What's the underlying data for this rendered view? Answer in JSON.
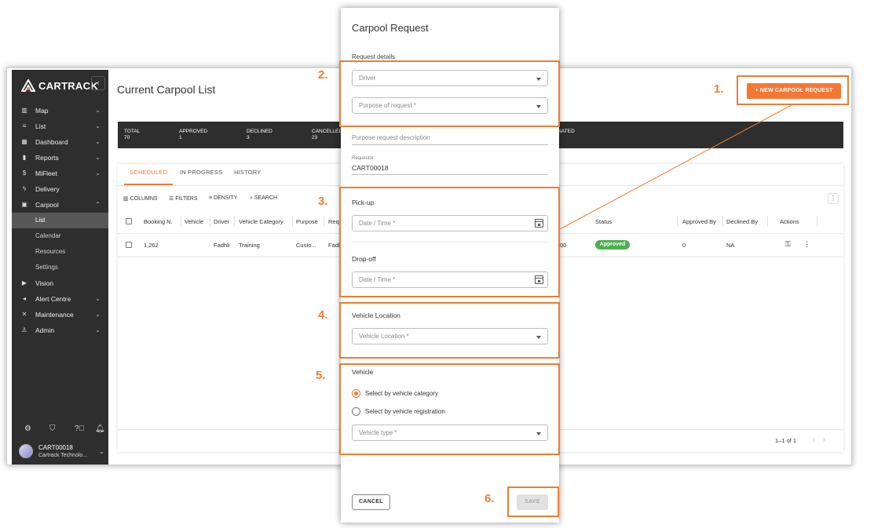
{
  "app": {
    "brand": "CARTRACK",
    "sidebar": {
      "items": [
        {
          "label": "Map",
          "icon": "map-icon",
          "chevron": true
        },
        {
          "label": "List",
          "icon": "list-icon",
          "chevron": true
        },
        {
          "label": "Dashboard",
          "icon": "dashboard-icon",
          "chevron": true
        },
        {
          "label": "Reports",
          "icon": "reports-icon",
          "chevron": true
        },
        {
          "label": "MiFleet",
          "icon": "dollar-icon",
          "chevron": true
        },
        {
          "label": "Delivery",
          "icon": "bolt-icon",
          "chevron": false
        },
        {
          "label": "Carpool",
          "icon": "calendar-icon",
          "chevron": true
        }
      ],
      "carpool_sub": [
        {
          "label": "List",
          "active": true
        },
        {
          "label": "Calendar",
          "active": false
        },
        {
          "label": "Resources",
          "active": false
        },
        {
          "label": "Settings",
          "active": false
        }
      ],
      "items_after": [
        {
          "label": "Vision",
          "icon": "camera-icon",
          "chevron": false
        },
        {
          "label": "Alert Centre",
          "icon": "alert-icon",
          "chevron": true
        },
        {
          "label": "Maintenance",
          "icon": "tools-icon",
          "chevron": true
        },
        {
          "label": "Admin",
          "icon": "admin-icon",
          "chevron": true
        }
      ],
      "user": {
        "name": "CART00018",
        "company": "Cartrack Technolo..."
      }
    },
    "main": {
      "title": "Current Carpool List",
      "new_button": "NEW CARPOOL REQUEST",
      "stats": [
        {
          "label": "TOTAL",
          "value": "70"
        },
        {
          "label": "APPROVED",
          "value": "1"
        },
        {
          "label": "DECLINED",
          "value": "3"
        },
        {
          "label": "CANCELLED",
          "value": "23"
        },
        {
          "label": "TERMINATED",
          "value": ""
        }
      ],
      "tabs": [
        "SCHEDULED",
        "IN PROGRESS",
        "HISTORY"
      ],
      "toolbar": [
        "COLUMNS",
        "FILTERS",
        "DENSITY",
        "SEARCH"
      ],
      "columns": [
        "Booking N.",
        "Vehicle",
        "Driver",
        "Vehicle Category",
        "Purpose",
        "Req",
        "Status",
        "Approved By",
        "Declined By",
        "Actions"
      ],
      "row": {
        "booking": "1,262",
        "vehicle": "",
        "driver": "Fadhli",
        "category": "Training",
        "purpose": "Custo...",
        "req": "Fadh",
        "time_tail": "00",
        "status": "Approved",
        "approved_by": "0",
        "declined_by": "NA"
      },
      "pagination": "1–1 of 1"
    }
  },
  "modal": {
    "title": "Carpool Request",
    "request_details_label": "Request details",
    "driver_placeholder": "Driver",
    "purpose_placeholder": "Purpose of request *",
    "purpose_desc_placeholder": "Purpose request description",
    "requestor_label": "Requestor",
    "requestor_value": "CART00018",
    "pickup_label": "Pick-up",
    "pickup_placeholder": "Date / Time *",
    "dropoff_label": "Drop-off",
    "dropoff_placeholder": "Date / Time *",
    "vehicle_location_label": "Vehicle Location",
    "vehicle_location_placeholder": "Vehicle Location *",
    "vehicle_label": "Vehicle",
    "radio_category": "Select by vehicle category",
    "radio_registration": "Select by vehicle registration",
    "vehicle_type_placeholder": "Vehicle type *",
    "cancel": "CANCEL",
    "save": "SAVE"
  },
  "annotations": {
    "step1": "1.",
    "step2": "2.",
    "step3": "3.",
    "step4": "4.",
    "step5": "5.",
    "step6": "6.",
    "color": "#ed7d31"
  }
}
